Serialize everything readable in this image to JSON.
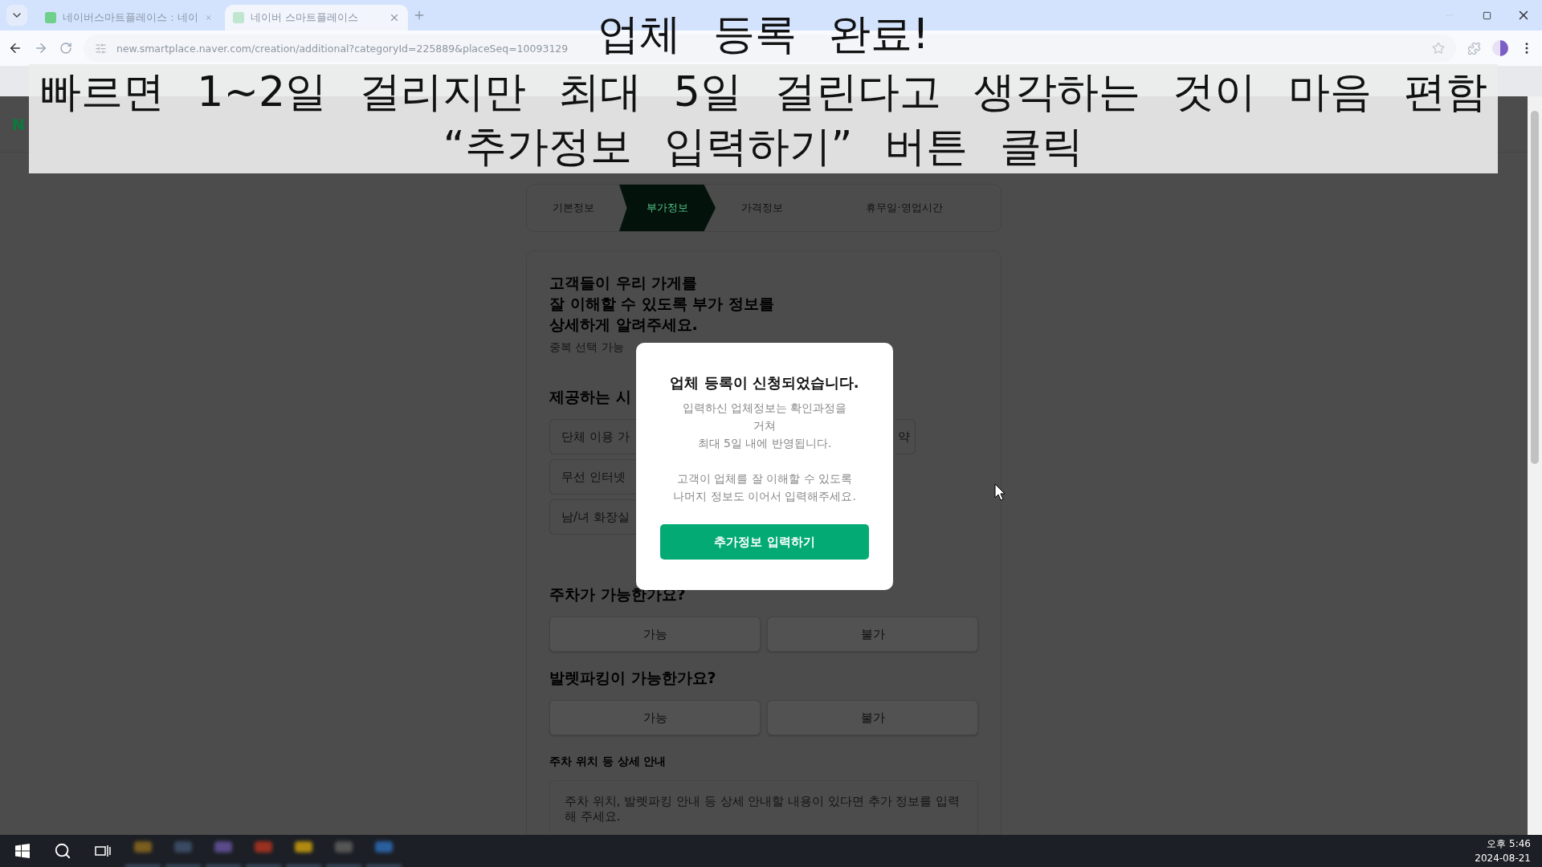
{
  "browser": {
    "tabs": [
      {
        "title": "네이버스마트플레이스 : 네이",
        "selected": false
      },
      {
        "title": "네이버 스마트플레이스",
        "selected": true
      }
    ],
    "url": "new.smartplace.naver.com/creation/additional?categoryId=225889&placeSeq=10093129"
  },
  "caption": {
    "lines": [
      "업체 등록 완료!",
      "빠르면 1~2일 걸리지만 최대 5일 걸린다고 생각하는 것이 마음 편함",
      "“추가정보 입력하기” 버튼 클릭"
    ]
  },
  "header": {
    "logo": "N"
  },
  "stepper": [
    {
      "label": "기본정보",
      "selected": false
    },
    {
      "label": "부가정보",
      "selected": true
    },
    {
      "label": "가격정보",
      "selected": false
    },
    {
      "label": "휴무일·영업시간",
      "selected": false
    }
  ],
  "intro": {
    "heading_lines": [
      "고객들이 우리 가게를",
      "잘 이해할 수 있도록 부가 정보를",
      "상세하게 알려주세요."
    ],
    "hint": "중복 선택 가능"
  },
  "facilities": {
    "title": "제공하는 시",
    "rows": [
      [
        {
          "label": "단체 이용 가"
        },
        {
          "label": "약"
        }
      ],
      [
        {
          "label": "무선 인터넷"
        }
      ],
      [
        {
          "label": "남/녀 화장실"
        }
      ]
    ]
  },
  "questions": [
    {
      "title": "주차가 가능한가요?",
      "options": [
        {
          "label": "가능",
          "selected": false
        },
        {
          "label": "불가",
          "selected": false
        }
      ]
    },
    {
      "title": "발렛파킹이 가능한가요?",
      "options": [
        {
          "label": "가능",
          "selected": false
        },
        {
          "label": "불가",
          "selected": false
        }
      ]
    }
  ],
  "detail": {
    "label": "주차 위치 등 상세 안내",
    "placeholder": "주차 위치, 발렛파킹 안내 등 상세 안내할 내용이 있다면 추가 정보를 입력해 주세요."
  },
  "modal": {
    "title": "업체 등록이 신청되었습니다.",
    "paragraphs": [
      [
        "입력하신 업체정보는 확인과정을",
        "거쳐",
        "최대 5일 내에 반영됩니다."
      ],
      [
        "고객이 업체를 잘 이해할 수 있도록",
        "나머지 정보도 이어서 입력해주세요."
      ]
    ],
    "button": "추가정보 입력하기"
  },
  "taskbar": {
    "time": "오후 5:46",
    "date": "2024-08-21"
  }
}
